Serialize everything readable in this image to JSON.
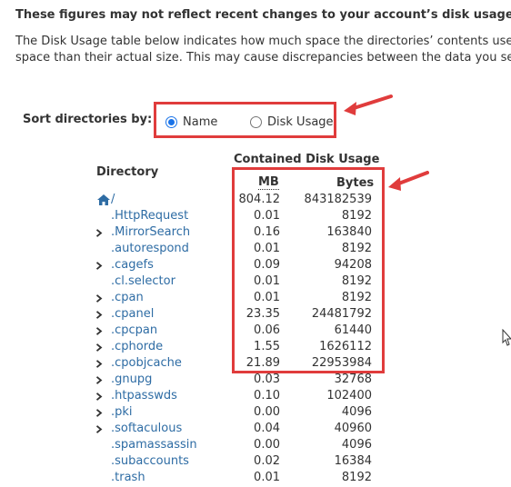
{
  "notice": {
    "title": "These figures may not reflect recent changes to your account’s disk usage.",
    "line1": "The Disk Usage table below indicates how much space the directories’ contents use,",
    "line2": "space than their actual size. This may cause discrepancies between the data you see"
  },
  "sort": {
    "label": "Sort directories by:",
    "options": [
      {
        "label": "Name",
        "checked": true
      },
      {
        "label": "Disk Usage",
        "checked": false
      }
    ]
  },
  "table": {
    "directory_header": "Directory",
    "contained_header": "Contained Disk Usage",
    "mb_header": "MB",
    "bytes_header": "Bytes",
    "rows": [
      {
        "name": "/",
        "mb": "804.12",
        "bytes": "843182539",
        "root": true,
        "expandable": false
      },
      {
        "name": ".HttpRequest",
        "mb": "0.01",
        "bytes": "8192",
        "expandable": false
      },
      {
        "name": ".MirrorSearch",
        "mb": "0.16",
        "bytes": "163840",
        "expandable": true
      },
      {
        "name": ".autorespond",
        "mb": "0.01",
        "bytes": "8192",
        "expandable": false
      },
      {
        "name": ".cagefs",
        "mb": "0.09",
        "bytes": "94208",
        "expandable": true
      },
      {
        "name": ".cl.selector",
        "mb": "0.01",
        "bytes": "8192",
        "expandable": false
      },
      {
        "name": ".cpan",
        "mb": "0.01",
        "bytes": "8192",
        "expandable": true
      },
      {
        "name": ".cpanel",
        "mb": "23.35",
        "bytes": "24481792",
        "expandable": true
      },
      {
        "name": ".cpcpan",
        "mb": "0.06",
        "bytes": "61440",
        "expandable": true
      },
      {
        "name": ".cphorde",
        "mb": "1.55",
        "bytes": "1626112",
        "expandable": true
      },
      {
        "name": ".cpobjcache",
        "mb": "21.89",
        "bytes": "22953984",
        "expandable": true
      },
      {
        "name": ".gnupg",
        "mb": "0.03",
        "bytes": "32768",
        "expandable": true
      },
      {
        "name": ".htpasswds",
        "mb": "0.10",
        "bytes": "102400",
        "expandable": true
      },
      {
        "name": ".pki",
        "mb": "0.00",
        "bytes": "4096",
        "expandable": true
      },
      {
        "name": ".softaculous",
        "mb": "0.04",
        "bytes": "40960",
        "expandable": true
      },
      {
        "name": ".spamassassin",
        "mb": "0.00",
        "bytes": "4096",
        "expandable": false
      },
      {
        "name": ".subaccounts",
        "mb": "0.02",
        "bytes": "16384",
        "expandable": false
      },
      {
        "name": ".trash",
        "mb": "0.01",
        "bytes": "8192",
        "expandable": false
      }
    ]
  },
  "colors": {
    "link": "#2e6ca4",
    "highlight": "#e03c3c",
    "radio_checked": "#1a73e8"
  },
  "icons": {
    "home": "home-icon",
    "chevron": "chevron-right-icon",
    "arrow": "annotation-arrow-icon",
    "cursor": "text-cursor-icon"
  }
}
